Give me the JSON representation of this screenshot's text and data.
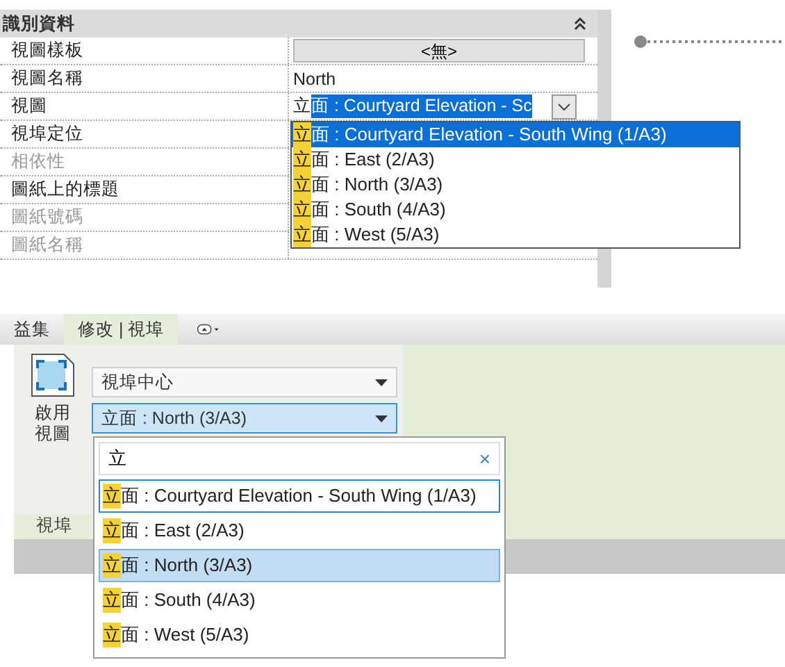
{
  "properties": {
    "group": {
      "title": "識別資料"
    },
    "rows": [
      {
        "label": "視圖樣板",
        "disabled": false,
        "kind": "button",
        "value": "<無>"
      },
      {
        "label": "視圖名稱",
        "disabled": false,
        "kind": "text",
        "value": "North"
      },
      {
        "label": "視圖",
        "disabled": false,
        "kind": "combo",
        "value_plain": "立",
        "value_selected": "面 : Courtyard Elevation - Sc"
      },
      {
        "label": "視埠定位",
        "disabled": false,
        "kind": "empty"
      },
      {
        "label": "相依性",
        "disabled": true,
        "kind": "empty"
      },
      {
        "label": "圖紙上的標題",
        "disabled": false,
        "kind": "empty"
      },
      {
        "label": "圖紙號碼",
        "disabled": true,
        "kind": "empty"
      },
      {
        "label": "圖紙名稱",
        "disabled": true,
        "kind": "empty"
      }
    ],
    "dropdown": [
      {
        "match": "立",
        "rest": "面 : Courtyard Elevation - South Wing (1/A3)",
        "selected": true
      },
      {
        "match": "立",
        "rest": "面 : East (2/A3)",
        "selected": false
      },
      {
        "match": "立",
        "rest": "面 : North (3/A3)",
        "selected": false
      },
      {
        "match": "立",
        "rest": "面 : South (4/A3)",
        "selected": false
      },
      {
        "match": "立",
        "rest": "面 : West (5/A3)",
        "selected": false
      }
    ]
  },
  "ribbon": {
    "tabs": [
      {
        "label": "益集",
        "selected": false
      },
      {
        "label": "修改 | 視埠",
        "selected": true
      }
    ],
    "activate_button": "啟用視圖",
    "panel_label": "視埠",
    "combos": [
      {
        "value": "視埠中心",
        "selected": false
      },
      {
        "value": "立面 : North (3/A3)",
        "selected": true
      }
    ],
    "popup": {
      "search": "立",
      "clear": "×",
      "items": [
        {
          "match": "立",
          "rest": "面 : Courtyard Elevation - South Wing (1/A3)",
          "hovered": true,
          "selected": false
        },
        {
          "match": "立",
          "rest": "面 : East (2/A3)",
          "hovered": false,
          "selected": false
        },
        {
          "match": "立",
          "rest": "面 : North (3/A3)",
          "hovered": false,
          "selected": true
        },
        {
          "match": "立",
          "rest": "面 : South (4/A3)",
          "hovered": false,
          "selected": false
        },
        {
          "match": "立",
          "rest": "面 : West (5/A3)",
          "hovered": false,
          "selected": false
        }
      ]
    }
  }
}
